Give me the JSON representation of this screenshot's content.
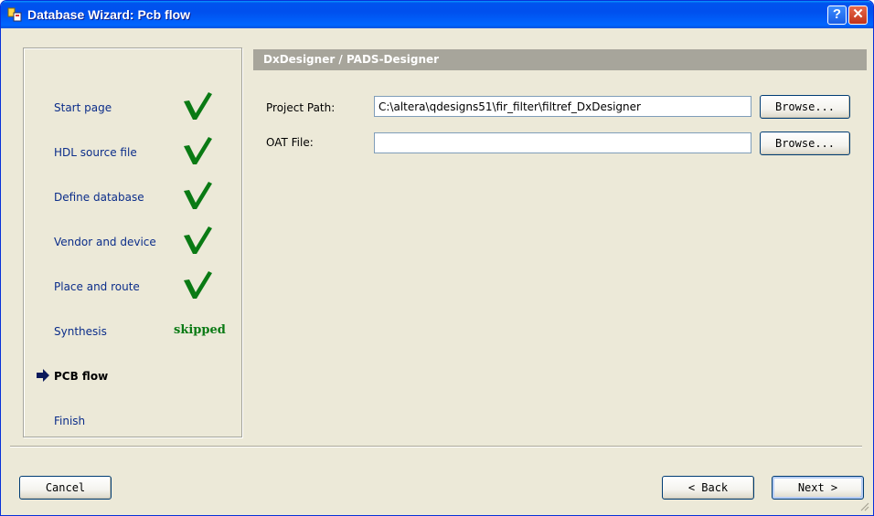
{
  "window": {
    "title": "Database Wizard: Pcb flow",
    "help_label": "?",
    "close_label": "✕"
  },
  "steps": [
    {
      "label": "Start page",
      "status": "done"
    },
    {
      "label": "HDL source file",
      "status": "done"
    },
    {
      "label": "Define database",
      "status": "done"
    },
    {
      "label": "Vendor and device",
      "status": "done"
    },
    {
      "label": "Place and route",
      "status": "done"
    },
    {
      "label": "Synthesis",
      "status": "skipped",
      "status_text": "skipped"
    },
    {
      "label": "PCB flow",
      "status": "current"
    },
    {
      "label": "Finish",
      "status": "pending"
    }
  ],
  "panel": {
    "header": "DxDesigner / PADS-Designer",
    "project_path_label": "Project Path:",
    "project_path_value": "C:\\altera\\qdesigns51\\fir_filter\\filtref_DxDesigner",
    "oat_file_label": "OAT File:",
    "oat_file_value": "",
    "browse_label": "Browse..."
  },
  "footer": {
    "cancel_label": "Cancel",
    "back_label": "< Back",
    "next_label": "Next >"
  },
  "colors": {
    "titlebar": "#0054e3",
    "check": "#0a7a14",
    "header_bg": "#a7a59b",
    "dialog_bg": "#ece9d8"
  },
  "icons": {
    "title": "wizard-app-icon",
    "done": "green-check-icon",
    "current": "right-arrow-icon"
  }
}
